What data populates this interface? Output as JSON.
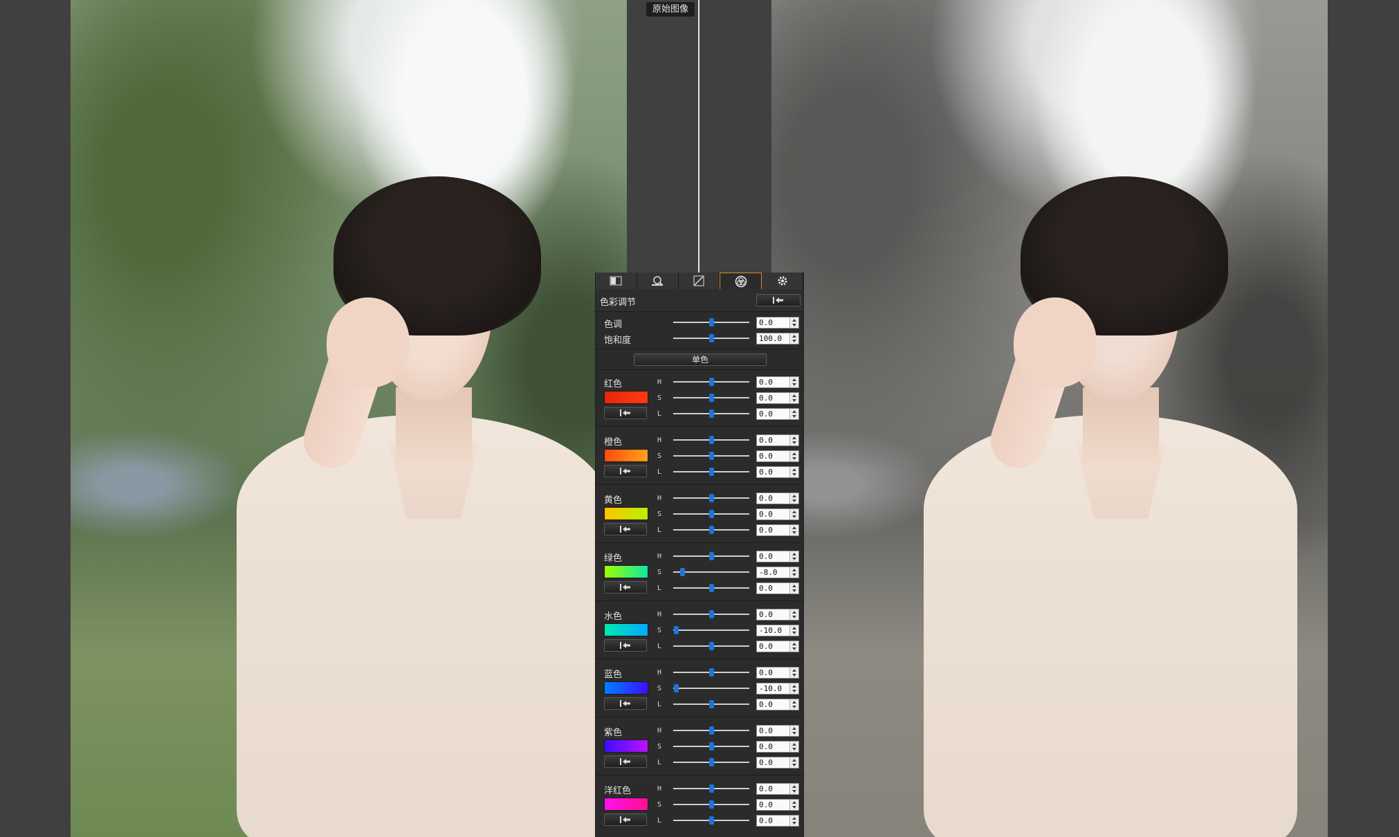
{
  "compare": {
    "original_label": "原始图像"
  },
  "panel": {
    "tabs": [
      {
        "icon": "histogram-icon"
      },
      {
        "icon": "lens-detail-icon"
      },
      {
        "icon": "tone-curve-icon"
      },
      {
        "icon": "color-adjust-icon",
        "active": true
      },
      {
        "icon": "gear-icon"
      }
    ],
    "title": "色彩调节",
    "hue_label": "色调",
    "hue_value": "0.0",
    "hue_level": 0.5,
    "saturation_label": "饱和度",
    "saturation_value": "100.0",
    "saturation_level": 0.5,
    "single_color_label": "单色",
    "hsl_letters": [
      "H",
      "S",
      "L"
    ],
    "colors": [
      {
        "name": "红色",
        "swatch": [
          "#e8260a",
          "#ff3a12"
        ],
        "values": [
          "0.0",
          "0.0",
          "0.0"
        ],
        "levels": [
          0.5,
          0.5,
          0.5
        ]
      },
      {
        "name": "橙色",
        "swatch": [
          "#ff4a10",
          "#ffa21a"
        ],
        "values": [
          "0.0",
          "0.0",
          "0.0"
        ],
        "levels": [
          0.5,
          0.5,
          0.5
        ]
      },
      {
        "name": "黄色",
        "swatch": [
          "#ffc400",
          "#b8f000"
        ],
        "values": [
          "0.0",
          "0.0",
          "0.0"
        ],
        "levels": [
          0.5,
          0.5,
          0.5
        ]
      },
      {
        "name": "绿色",
        "swatch": [
          "#9cff00",
          "#10e8a0"
        ],
        "values": [
          "0.0",
          "-8.0",
          "0.0"
        ],
        "levels": [
          0.5,
          0.12,
          0.5
        ]
      },
      {
        "name": "水色",
        "swatch": [
          "#00e8b0",
          "#00aaff"
        ],
        "values": [
          "0.0",
          "-10.0",
          "0.0"
        ],
        "levels": [
          0.5,
          0.04,
          0.5
        ]
      },
      {
        "name": "蓝色",
        "swatch": [
          "#0080ff",
          "#3a10ff"
        ],
        "values": [
          "0.0",
          "-10.0",
          "0.0"
        ],
        "levels": [
          0.5,
          0.04,
          0.5
        ]
      },
      {
        "name": "紫色",
        "swatch": [
          "#3a10ff",
          "#c010ff"
        ],
        "values": [
          "0.0",
          "0.0",
          "0.0"
        ],
        "levels": [
          0.5,
          0.5,
          0.5
        ]
      },
      {
        "name": "洋红色",
        "swatch": [
          "#ff10f0",
          "#ff1090"
        ],
        "values": [
          "0.0",
          "0.0",
          "0.0"
        ],
        "levels": [
          0.5,
          0.5,
          0.5
        ]
      }
    ]
  },
  "style": {
    "accent": "#e08a2e",
    "slider_thumb": "#1f74d6"
  }
}
